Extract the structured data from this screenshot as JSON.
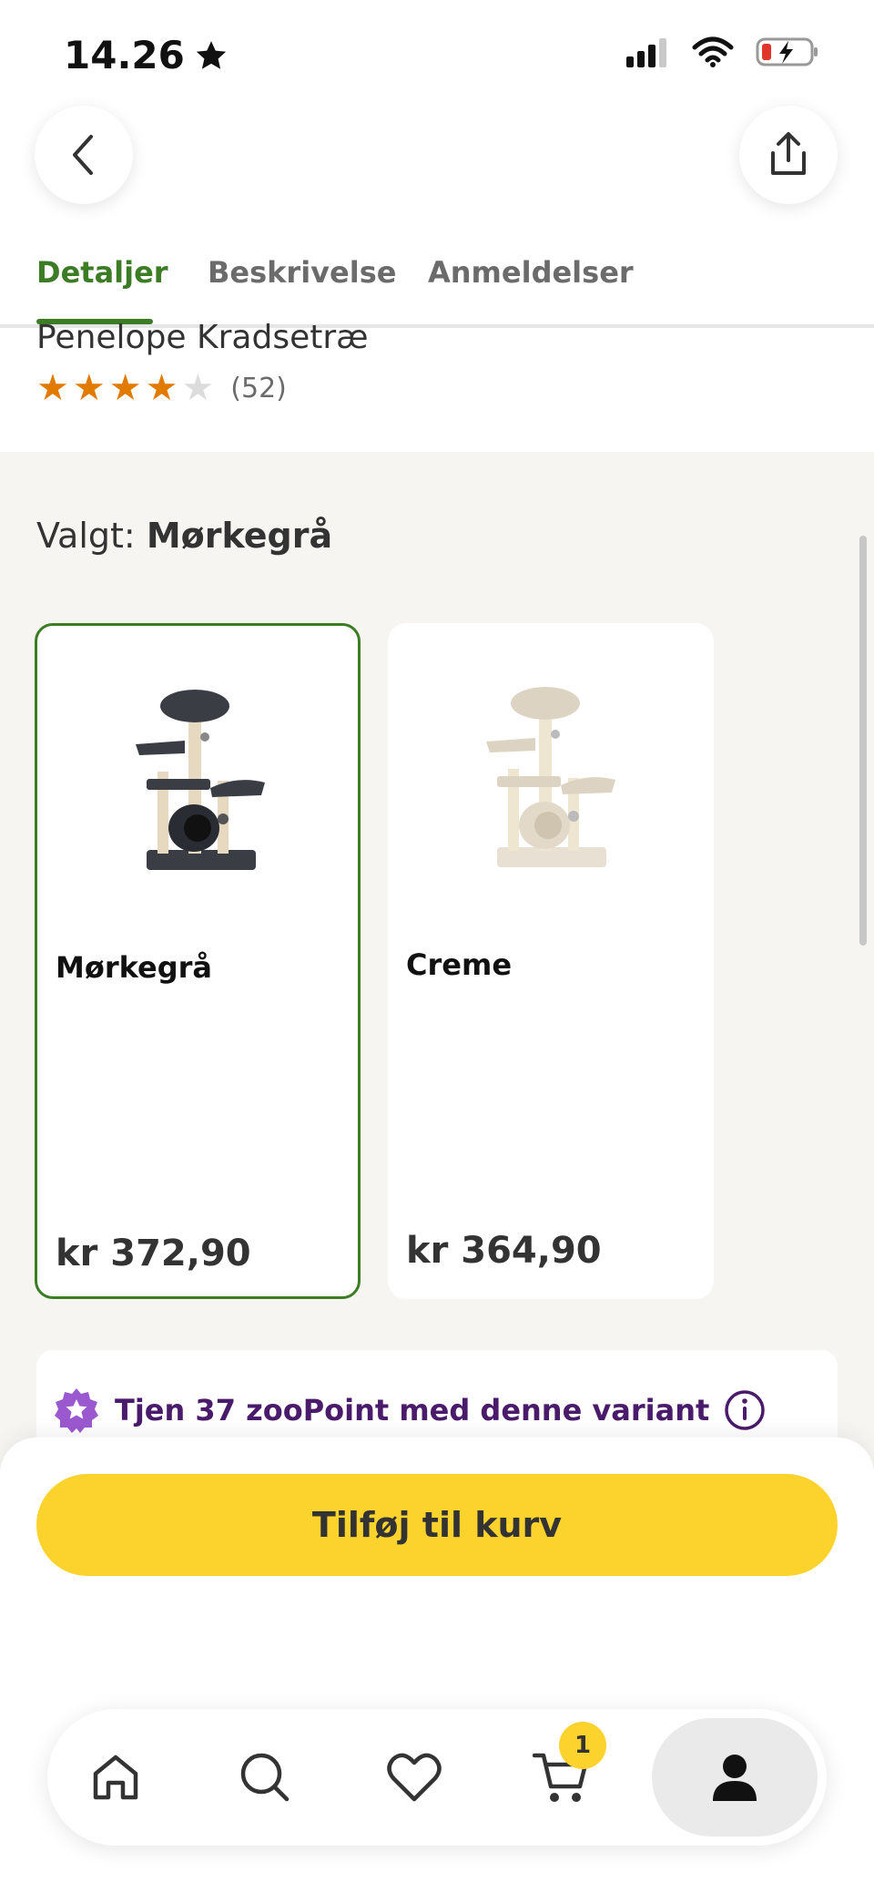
{
  "status_bar": {
    "time": "14.26"
  },
  "tabs": [
    {
      "label": "Detaljer"
    },
    {
      "label": "Beskrivelse"
    },
    {
      "label": "Anmeldelser"
    }
  ],
  "product": {
    "title": "Penelope Kradsetræ",
    "rating": 4,
    "rating_max": 5,
    "review_count": "(52)"
  },
  "selected": {
    "prefix": "Valgt:",
    "value": "Mørkegrå"
  },
  "variants": [
    {
      "name": "Mørkegrå",
      "price": "kr 372,90",
      "selected": true,
      "color": "#3b3d45"
    },
    {
      "name": "Creme",
      "price": "kr 364,90",
      "selected": false,
      "color": "#e8e0d2"
    }
  ],
  "points": {
    "text": "Tjen 37 zooPoint med denne variant"
  },
  "cta": {
    "label": "Tilføj til kurv"
  },
  "nav": {
    "items": [
      "home-icon",
      "search-icon",
      "heart-icon",
      "cart-icon",
      "user-icon"
    ],
    "cart_count": "1"
  },
  "colors": {
    "accent": "#3c7c25",
    "cta": "#fcd32d",
    "star": "#e07b00",
    "points": "#4a1a6b"
  }
}
